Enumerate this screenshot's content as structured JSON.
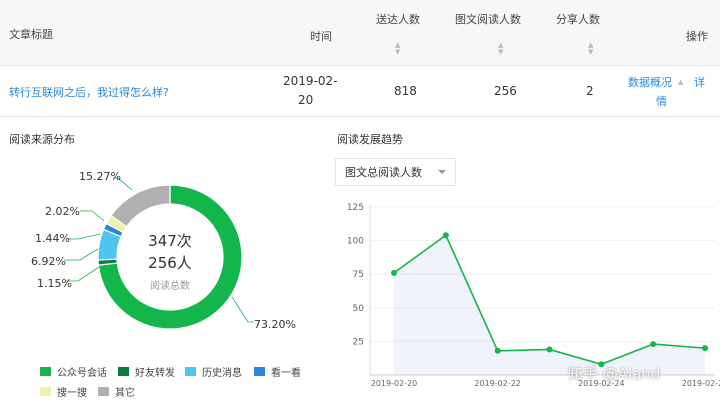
{
  "table": {
    "headers": {
      "title": "文章标题",
      "time": "时间",
      "reach": "送达人数",
      "read": "图文阅读人数",
      "share": "分享人数",
      "actions": "操作"
    },
    "row": {
      "title": "转行互联网之后，我过得怎么样?",
      "date_line1": "2019-02-",
      "date_line2": "20",
      "reach": "818",
      "read": "256",
      "share": "2",
      "action_detail_line1": "数据概况",
      "action_detail_line2": "情",
      "action_more": "详"
    }
  },
  "pie": {
    "title": "阅读来源分布",
    "center_count": "347次",
    "center_people": "256人",
    "center_caption": "阅读总数",
    "chart_data": {
      "type": "pie",
      "slices": [
        {
          "name": "公众号会话",
          "value": 73.2,
          "label": "73.20%",
          "color": "#13b64a"
        },
        {
          "name": "好友转发",
          "value": 1.15,
          "label": "1.15%",
          "color": "#0b7a3d"
        },
        {
          "name": "历史消息",
          "value": 6.92,
          "label": "6.92%",
          "color": "#4fc5ef"
        },
        {
          "name": "看一看",
          "value": 1.44,
          "label": "1.44%",
          "color": "#2a85dc"
        },
        {
          "name": "搜一搜",
          "value": 2.02,
          "label": "2.02%",
          "color": "#eef1a6"
        },
        {
          "name": "其它",
          "value": 15.27,
          "label": "15.27%",
          "color": "#b0b0b0"
        }
      ]
    }
  },
  "trend": {
    "title": "阅读发展趋势",
    "dropdown_value": "图文总阅读人数",
    "chart_data": {
      "type": "area",
      "x": [
        "2019-02-20",
        "2019-02-21",
        "2019-02-22",
        "2019-02-23",
        "2019-02-24",
        "2019-02-25",
        "2019-02-26"
      ],
      "x_tick_labels": [
        "2019-02-20",
        "2019-02-22",
        "2019-02-24",
        "2019-02-26"
      ],
      "values": [
        76,
        104,
        18,
        19,
        8,
        23,
        20
      ],
      "y_ticks": [
        "25",
        "50",
        "75",
        "100",
        "125"
      ],
      "ylim": [
        0,
        125
      ],
      "color": "#13b64a"
    }
  },
  "watermark": "知乎 @Aland"
}
